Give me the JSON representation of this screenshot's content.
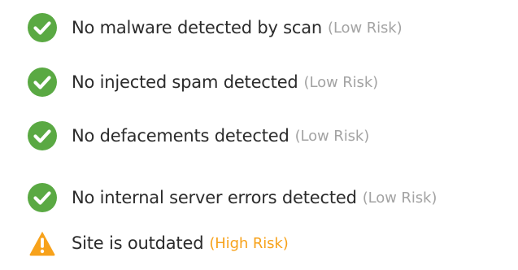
{
  "results": [
    {
      "icon": "check-circle-icon",
      "status": "ok",
      "label": "No malware detected by scan",
      "risk": "(Low Risk)"
    },
    {
      "icon": "check-circle-icon",
      "status": "ok",
      "label": "No injected spam detected",
      "risk": "(Low Risk)"
    },
    {
      "icon": "check-circle-icon",
      "status": "ok",
      "label": "No defacements detected",
      "risk": "(Low Risk)"
    },
    {
      "icon": "check-circle-icon",
      "status": "ok",
      "label": "No internal server errors detected",
      "risk": "(Low Risk)"
    },
    {
      "icon": "warning-triangle-icon",
      "status": "warning",
      "label": "Site is outdated",
      "risk": "(High Risk)"
    }
  ],
  "colors": {
    "ok": "#5aa943",
    "warning": "#f7a21b",
    "low_risk_text": "#a3a3a3",
    "high_risk_text": "#f7a21b",
    "label_text": "#2b2b2b"
  }
}
